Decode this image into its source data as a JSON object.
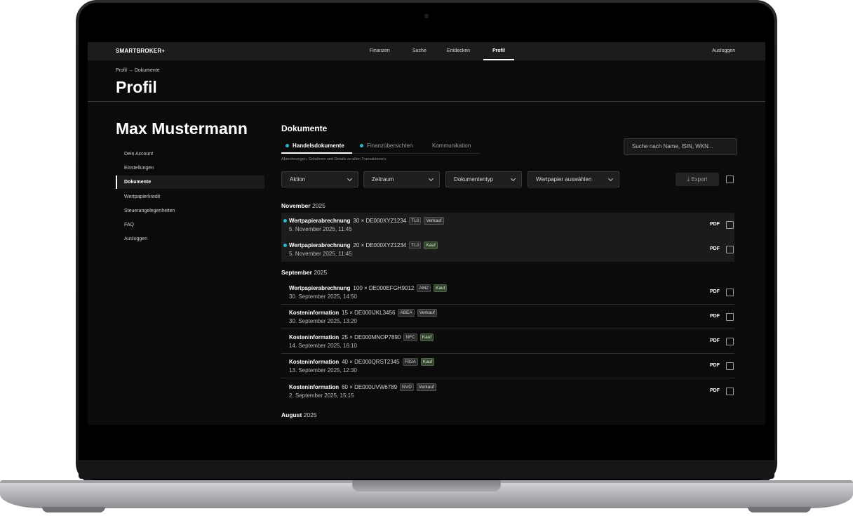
{
  "topnav": {
    "logo": "SMARTBROKER+",
    "items": [
      "Finanzen",
      "Suche",
      "Entdecken",
      "Profil"
    ],
    "active": "Profil",
    "logout": "Ausloggen"
  },
  "breadcrumb": "Profil → Dokumente",
  "page_title": "Profil",
  "user_name": "Max Mustermann",
  "sidebar": {
    "items": [
      "Dein Account",
      "Einstellungen",
      "Dokumente",
      "Wertpapierkredit",
      "Steuerangelegenheiten",
      "FAQ",
      "Ausloggen"
    ],
    "active": "Dokumente"
  },
  "documents": {
    "title": "Dokumente",
    "tabs": [
      "Handelsdokumente",
      "Finanzübersichten",
      "Kommunikation"
    ],
    "active_tab": "Handelsdokumente",
    "tab_description": "Abrechnungen, Gebühren und Details zu allen Transaktionen.",
    "search_placeholder": "Suche nach Name, ISIN, WKN...",
    "filters": [
      "Aktion",
      "Zeitraum",
      "Dokumententyp",
      "Wertpapier auswählen"
    ],
    "export_label": "Export",
    "accent_color": "#26b8c9",
    "groups": [
      {
        "month": "November",
        "year": "2025",
        "rows": [
          {
            "type": "Wertpapierabrechnung",
            "detail": "30 × DE000XYZ1234",
            "ticker": "TL0",
            "action": "Verkauf",
            "date": "5. November 2025, 11:45",
            "file": "PDF",
            "unread": true
          },
          {
            "type": "Wertpapierabrechnung",
            "detail": "20 × DE000XYZ1234",
            "ticker": "TL0",
            "action": "Kauf",
            "date": "5. November 2025, 11:45",
            "file": "PDF",
            "unread": true
          }
        ]
      },
      {
        "month": "September",
        "year": "2025",
        "rows": [
          {
            "type": "Wertpapierabrechnung",
            "detail": "100 × DE000EFGH9012",
            "ticker": "AMZ",
            "action": "Kauf",
            "date": "30. September 2025, 14:50",
            "file": "PDF",
            "unread": false
          },
          {
            "type": "Kosteninformation",
            "detail": "15 × DE000IJKL3456",
            "ticker": "ABEA",
            "action": "Verkauf",
            "date": "30. September 2025, 13:20",
            "file": "PDF",
            "unread": false
          },
          {
            "type": "Kosteninformation",
            "detail": "25 × DE000MNOP7890",
            "ticker": "NFC",
            "action": "Kauf",
            "date": "14. September 2025, 16:10",
            "file": "PDF",
            "unread": false
          },
          {
            "type": "Kosteninformation",
            "detail": "40 × DE000QRST2345",
            "ticker": "FB2A",
            "action": "Kauf",
            "date": "13. September 2025, 12:30",
            "file": "PDF",
            "unread": false
          },
          {
            "type": "Kosteninformation",
            "detail": "60 × DE000UVW6789",
            "ticker": "NVD",
            "action": "Verkauf",
            "date": "2. September 2025, 15:15",
            "file": "PDF",
            "unread": false
          }
        ]
      },
      {
        "month": "August",
        "year": "2025",
        "rows": []
      }
    ]
  }
}
